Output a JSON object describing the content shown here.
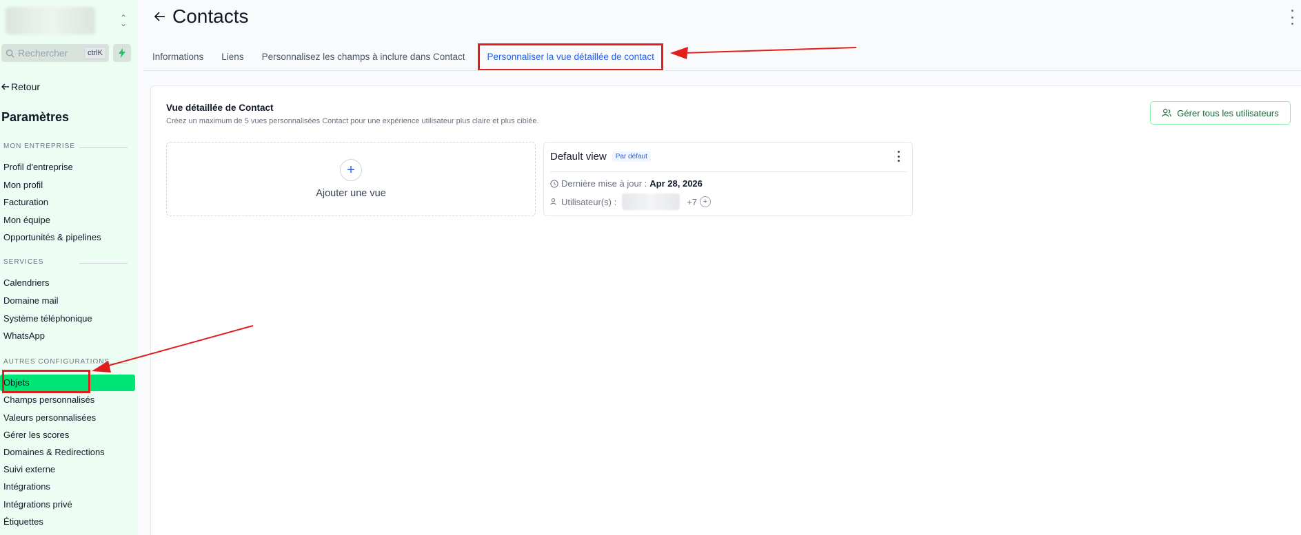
{
  "sidebar": {
    "search": {
      "placeholder": "Rechercher",
      "shortcut": "ctrlK"
    },
    "back_label": "Retour",
    "title": "Paramètres",
    "sections": [
      {
        "label": "MON ENTREPRISE",
        "items": [
          "Profil d'entreprise",
          "Mon profil",
          "Facturation",
          "Mon équipe",
          "Opportunités & pipelines"
        ]
      },
      {
        "label": "SERVICES",
        "items": [
          "Calendriers",
          "Domaine mail",
          "Système téléphonique",
          "WhatsApp"
        ]
      },
      {
        "label": "AUTRES CONFIGURATIONS",
        "items": [
          "Objets",
          "Champs personnalisés",
          "Valeurs personnalisées",
          "Gérer les scores",
          "Domaines & Redirections",
          "Suivi externe",
          "Intégrations",
          "Intégrations privé",
          "Étiquettes"
        ]
      }
    ],
    "active_item": "Objets"
  },
  "header": {
    "title": "Contacts"
  },
  "tabs": [
    {
      "label": "Informations"
    },
    {
      "label": "Liens"
    },
    {
      "label": "Personnalisez les champs à inclure dans Contact"
    },
    {
      "label": "Personnaliser la vue détaillée de contact",
      "active": true
    }
  ],
  "panel": {
    "title": "Vue détaillée de Contact",
    "subtitle": "Créez un maximum de 5 vues personnalisées Contact pour une expérience utilisateur plus claire et plus ciblée.",
    "manage_button": "Gérer tous les utilisateurs",
    "add_view_label": "Ajouter une vue",
    "view_card": {
      "name": "Default view",
      "badge": "Par défaut",
      "updated_label": "Dernière mise à jour :",
      "updated_value": "Apr 28, 2026",
      "users_label": "Utilisateur(s) :",
      "users_extra": "+7"
    }
  },
  "colors": {
    "accent": "#2563eb",
    "active_nav": "#00e676",
    "annotation": "#e11d1d",
    "sidebar_bg": "#ecfdf3"
  }
}
